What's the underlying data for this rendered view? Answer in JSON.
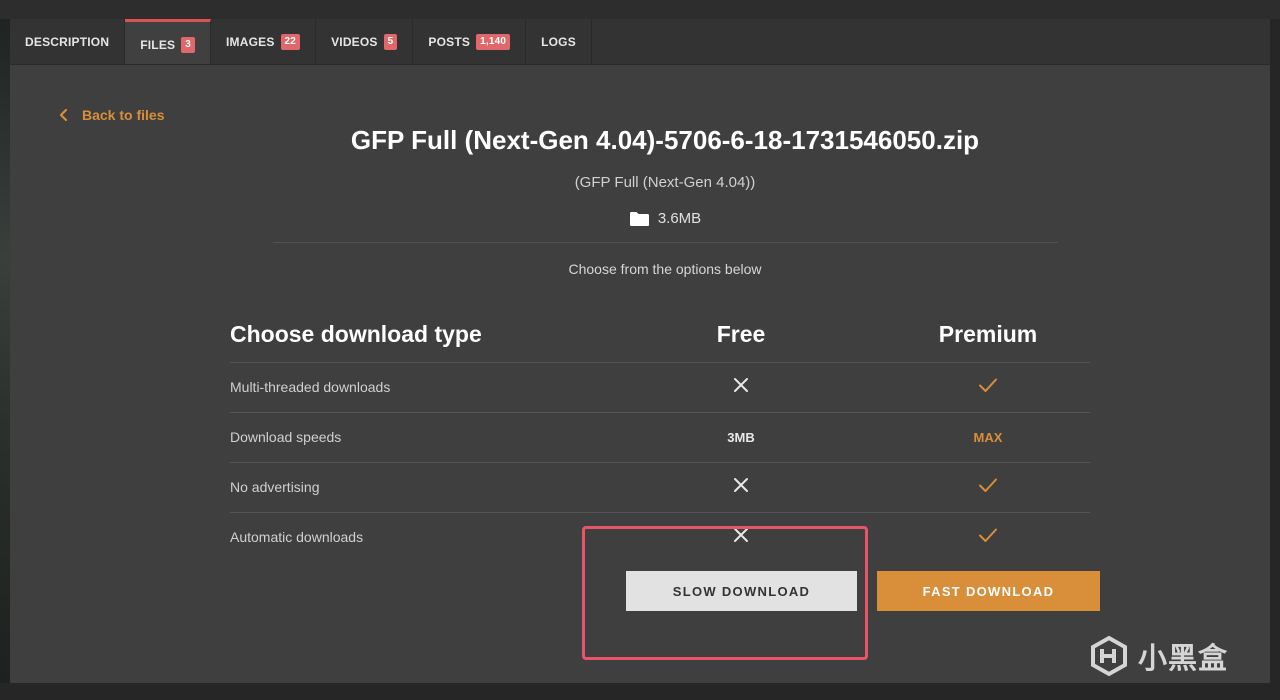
{
  "tabs": [
    {
      "label": "DESCRIPTION",
      "count": ""
    },
    {
      "label": "FILES",
      "count": "3"
    },
    {
      "label": "IMAGES",
      "count": "22"
    },
    {
      "label": "VIDEOS",
      "count": "5"
    },
    {
      "label": "POSTS",
      "count": "1,140"
    },
    {
      "label": "LOGS",
      "count": ""
    }
  ],
  "active_tab": "FILES",
  "back_link": "Back to files",
  "file": {
    "name": "GFP Full (Next-Gen 4.04)-5706-6-18-1731546050.zip",
    "subtitle": "(GFP Full (Next-Gen 4.04))",
    "size": "3.6MB",
    "size_icon": "folder-icon"
  },
  "choose_note": "Choose from the options below",
  "comparison": {
    "heading": "Choose download type",
    "free_heading": "Free",
    "premium_heading": "Premium",
    "rows": [
      {
        "label": "Multi-threaded downloads",
        "free": "cross-icon",
        "premium": "check-icon"
      },
      {
        "label": "Download speeds",
        "free": "3MB",
        "premium": "MAX"
      },
      {
        "label": "No advertising",
        "free": "cross-icon",
        "premium": "check-icon"
      },
      {
        "label": "Automatic downloads",
        "free": "cross-icon",
        "premium": "check-icon"
      }
    ]
  },
  "buttons": {
    "slow": "SLOW DOWNLOAD",
    "fast": "FAST DOWNLOAD"
  },
  "watermark": "小黑盒",
  "colors": {
    "accent": "#d98e3a",
    "badge": "#e0676a",
    "highlight": "#e85568",
    "active_tab_border": "#d9534f"
  }
}
